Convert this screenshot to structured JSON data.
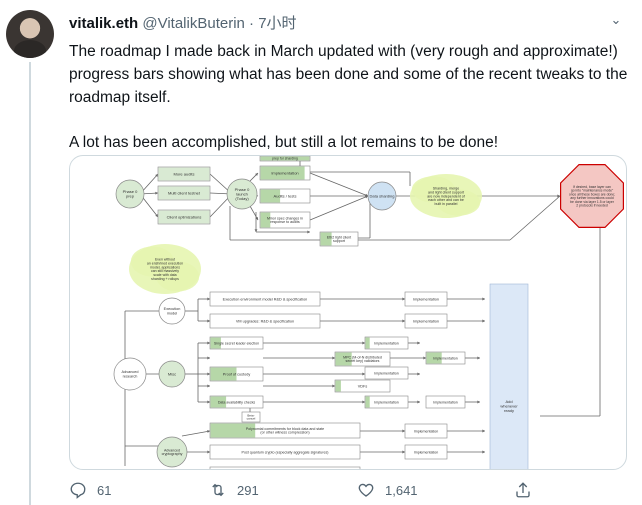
{
  "tweet": {
    "display_name": "vitalik.eth",
    "handle": "@VitalikButerin",
    "separator": "·",
    "time": "7小时",
    "text_p1": "The roadmap I made back in March updated with (very rough and approximate!) progress bars showing what has been done and some of the recent tweaks to the roadmap itself.",
    "text_p2": "A lot has been accomplished, but still a lot remains to be done!"
  },
  "actions": {
    "replies": "61",
    "retweets": "291",
    "likes": "1,641"
  },
  "roadmap": {
    "top_box_partial": "prep for sharding",
    "phase0": "Phase 0\nprep",
    "more_audits": "More audits",
    "multi_client": "Multi client testnet",
    "client_opt": "Client optimizations",
    "phase0_launch": "Phase 0\nlaunch\n(Today)",
    "implementation": "Implementation",
    "audits_tests": "Audits / tests",
    "minor_spec": "Minor spec changes in\nresponse to audits",
    "data_sharding": "Data sharding",
    "shard_note": "Sharding, merge\nand light client support\nare now independent of\neach other and can be\nbuilt in parallel",
    "octagon": "If desired, base layer can\ngo into \"maintenance mode\"\nonce all these boxes are done;\nany further innovations could\nbe done via layer 1.5 or layer\n2 protocols if needed",
    "eth2_light": "Eth2 light client\nsupport",
    "exec_note": "Even without\nan enshrined execution\nmodel, applications\ncan still massively\nscale with data\nsharding + rollups",
    "exec_model": "Execution\nmodel",
    "exec_env": "Execution environment model R&D & specification",
    "vm_upgrades": "VM upgrades: R&D & specification",
    "advanced_research": "Advanced\nresearch",
    "misc": "Misc",
    "ssle": "Single secret leader election",
    "mpc": "MPC (M-of-N distributed\nsecret key) validators",
    "proof_custody": "Proof of custody",
    "vdfs": "VDFs",
    "das": "Data availability checks",
    "beta_cancel": "Beta-\ncancel",
    "advanced_crypto": "Advanced\ncryptography",
    "polynomial": "Polynomial commitments for block data and state\n(or other witness compression)",
    "post_quantum": "Post quantum crypto (especially aggregate signatures)",
    "add_whenever": "Add\nwhenever\nready",
    "colors": {
      "green_fill": "#d9ead3",
      "green_progress": "#b6d7a8",
      "blue_fill": "#cfe2f3",
      "blue_column": "#dce8f7",
      "red_fill": "#f4c7c3",
      "red_stroke": "#cc0000",
      "highlight": "#e5f5b0",
      "line": "#666666"
    }
  }
}
